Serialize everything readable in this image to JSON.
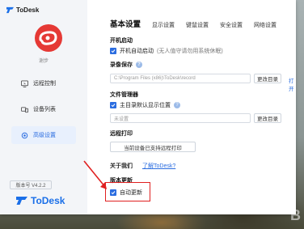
{
  "app": {
    "title": "ToDesk"
  },
  "sidebar": {
    "avatar_name": "谢步",
    "items": [
      {
        "label": "远程控制",
        "icon": "monitor-icon"
      },
      {
        "label": "设备列表",
        "icon": "devices-icon"
      },
      {
        "label": "高级设置",
        "icon": "gear-icon",
        "active": true
      }
    ],
    "version": "版本号 V4.2.2",
    "brand": "ToDesk"
  },
  "tabs": [
    {
      "label": "基本设置",
      "active": true
    },
    {
      "label": "显示设置"
    },
    {
      "label": "键鼠设置"
    },
    {
      "label": "安全设置"
    },
    {
      "label": "网络设置"
    }
  ],
  "sections": {
    "startup": {
      "title": "开机启动",
      "checkbox_label": "开机自动启动",
      "hint": "(无人值守请勿用系统休眠)",
      "checked": true
    },
    "recording": {
      "title": "录像保存",
      "path": "C:\\Program Files (x86)\\ToDesk\\record",
      "change_dir_label": "更改目录",
      "open_label": "打开"
    },
    "file_manager": {
      "title": "文件管理器",
      "checkbox_label": "主目录默认显示位置",
      "checked": true,
      "placeholder": "未设置",
      "change_dir_label": "更改目录"
    },
    "remote_print": {
      "title": "远程打印",
      "button_label": "当前设备已支持远程打印"
    },
    "about": {
      "title": "关于我们",
      "link_label": "了解ToDesk?"
    },
    "update": {
      "title": "版本更新",
      "checkbox_label": "自动更新",
      "checked": true
    }
  },
  "colors": {
    "accent": "#2b6de0",
    "highlight": "#e02020"
  }
}
